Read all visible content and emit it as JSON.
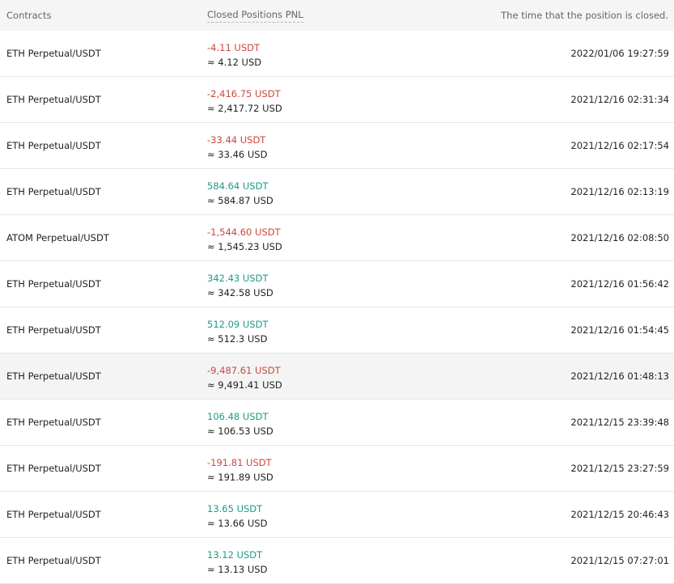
{
  "header": {
    "contracts": "Contracts",
    "pnl": "Closed Positions PNL",
    "time": "The time that the position is closed."
  },
  "colors": {
    "negative": "#c8483d",
    "positive": "#1e9a86",
    "header_bg": "#f5f5f5",
    "hover_bg": "#f4f4f4"
  },
  "rows": [
    {
      "contract": "ETH Perpetual/USDT",
      "usdt": "-4.11 USDT",
      "usd": "≈ 4.12 USD",
      "time": "2022/01/06 19:27:59",
      "direction": "neg"
    },
    {
      "contract": "ETH Perpetual/USDT",
      "usdt": "-2,416.75 USDT",
      "usd": "≈ 2,417.72 USD",
      "time": "2021/12/16 02:31:34",
      "direction": "neg"
    },
    {
      "contract": "ETH Perpetual/USDT",
      "usdt": "-33.44 USDT",
      "usd": "≈ 33.46 USD",
      "time": "2021/12/16 02:17:54",
      "direction": "neg"
    },
    {
      "contract": "ETH Perpetual/USDT",
      "usdt": "584.64 USDT",
      "usd": "≈ 584.87 USD",
      "time": "2021/12/16 02:13:19",
      "direction": "pos"
    },
    {
      "contract": "ATOM Perpetual/USDT",
      "usdt": "-1,544.60 USDT",
      "usd": "≈ 1,545.23 USD",
      "time": "2021/12/16 02:08:50",
      "direction": "neg"
    },
    {
      "contract": "ETH Perpetual/USDT",
      "usdt": "342.43 USDT",
      "usd": "≈ 342.58 USD",
      "time": "2021/12/16 01:56:42",
      "direction": "pos"
    },
    {
      "contract": "ETH Perpetual/USDT",
      "usdt": "512.09 USDT",
      "usd": "≈ 512.3 USD",
      "time": "2021/12/16 01:54:45",
      "direction": "pos"
    },
    {
      "contract": "ETH Perpetual/USDT",
      "usdt": "-9,487.61 USDT",
      "usd": "≈ 9,491.41 USD",
      "time": "2021/12/16 01:48:13",
      "direction": "neg",
      "highlighted": true
    },
    {
      "contract": "ETH Perpetual/USDT",
      "usdt": "106.48 USDT",
      "usd": "≈ 106.53 USD",
      "time": "2021/12/15 23:39:48",
      "direction": "pos"
    },
    {
      "contract": "ETH Perpetual/USDT",
      "usdt": "-191.81 USDT",
      "usd": "≈ 191.89 USD",
      "time": "2021/12/15 23:27:59",
      "direction": "neg"
    },
    {
      "contract": "ETH Perpetual/USDT",
      "usdt": "13.65 USDT",
      "usd": "≈ 13.66 USD",
      "time": "2021/12/15 20:46:43",
      "direction": "pos"
    },
    {
      "contract": "ETH Perpetual/USDT",
      "usdt": "13.12 USDT",
      "usd": "≈ 13.13 USD",
      "time": "2021/12/15 07:27:01",
      "direction": "pos"
    }
  ]
}
